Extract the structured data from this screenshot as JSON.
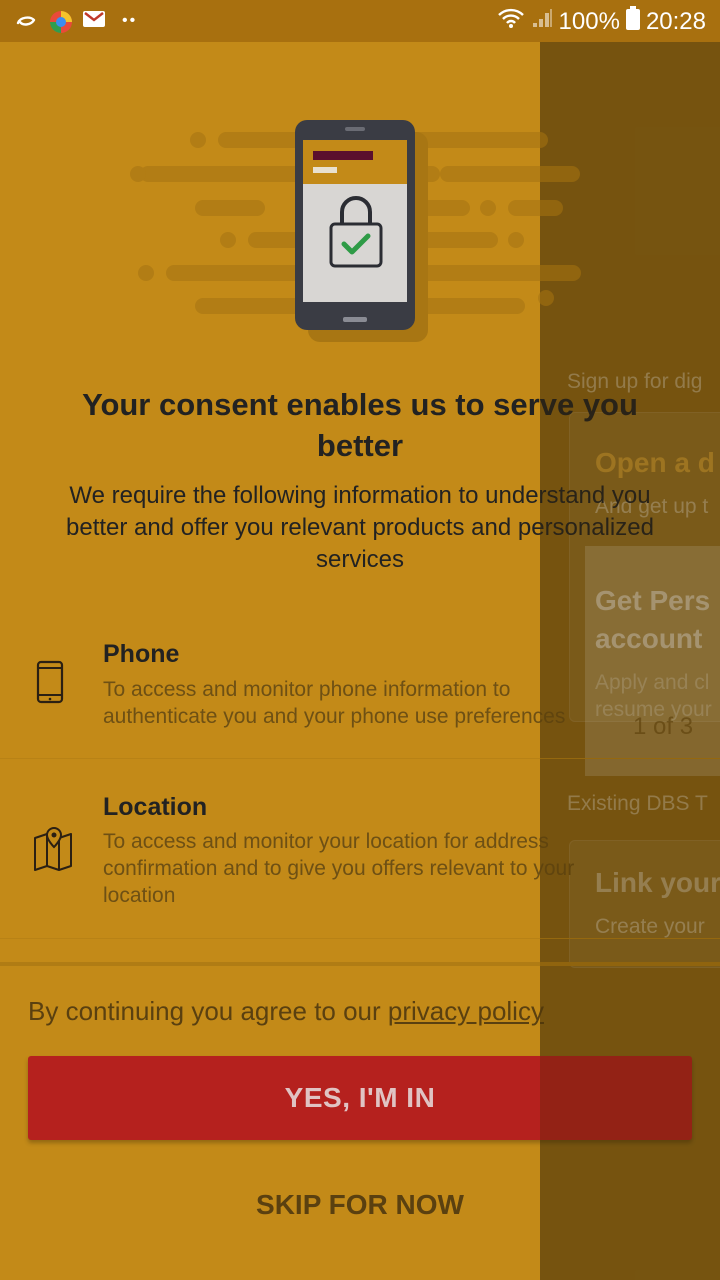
{
  "status_bar": {
    "left_icons": [
      "notification-swirl-icon",
      "browser-icon",
      "gmail-icon",
      "more-dots-icon"
    ],
    "battery_text": "100%",
    "time": "20:28"
  },
  "background_app": {
    "section_label": "Sign up for dig",
    "card1_title": "Open a d",
    "card1_sub": "And get up t",
    "card2_title_line1": "Get Pers",
    "card2_title_line2": "account",
    "card2_sub_line1": "Apply and cl",
    "card2_sub_line2": "resume your",
    "pager": "1 of 3",
    "section_label2": "Existing DBS T",
    "card3_title": "Link your",
    "card3_sub": "Create your"
  },
  "consent": {
    "title": "Your consent enables us to serve you better",
    "subtitle": "We require the following information to understand you better and offer you relevant products and personalized services",
    "permissions": [
      {
        "icon": "phone-icon",
        "title": "Phone",
        "description": "To access and monitor phone information to authenticate you and your phone use preferences"
      },
      {
        "icon": "map-pin-icon",
        "title": "Location",
        "description": "To access and monitor your location for address confirmation and to give you offers relevant to your location"
      }
    ],
    "privacy_prefix": "By continuing you agree to our ",
    "privacy_link": "privacy policy",
    "yes_button": "YES, I'M IN",
    "skip_button": "SKIP FOR NOW"
  },
  "colors": {
    "overlay": "#c38a18",
    "primary_button": "#b5211e",
    "status_bar": "#a8700f"
  }
}
